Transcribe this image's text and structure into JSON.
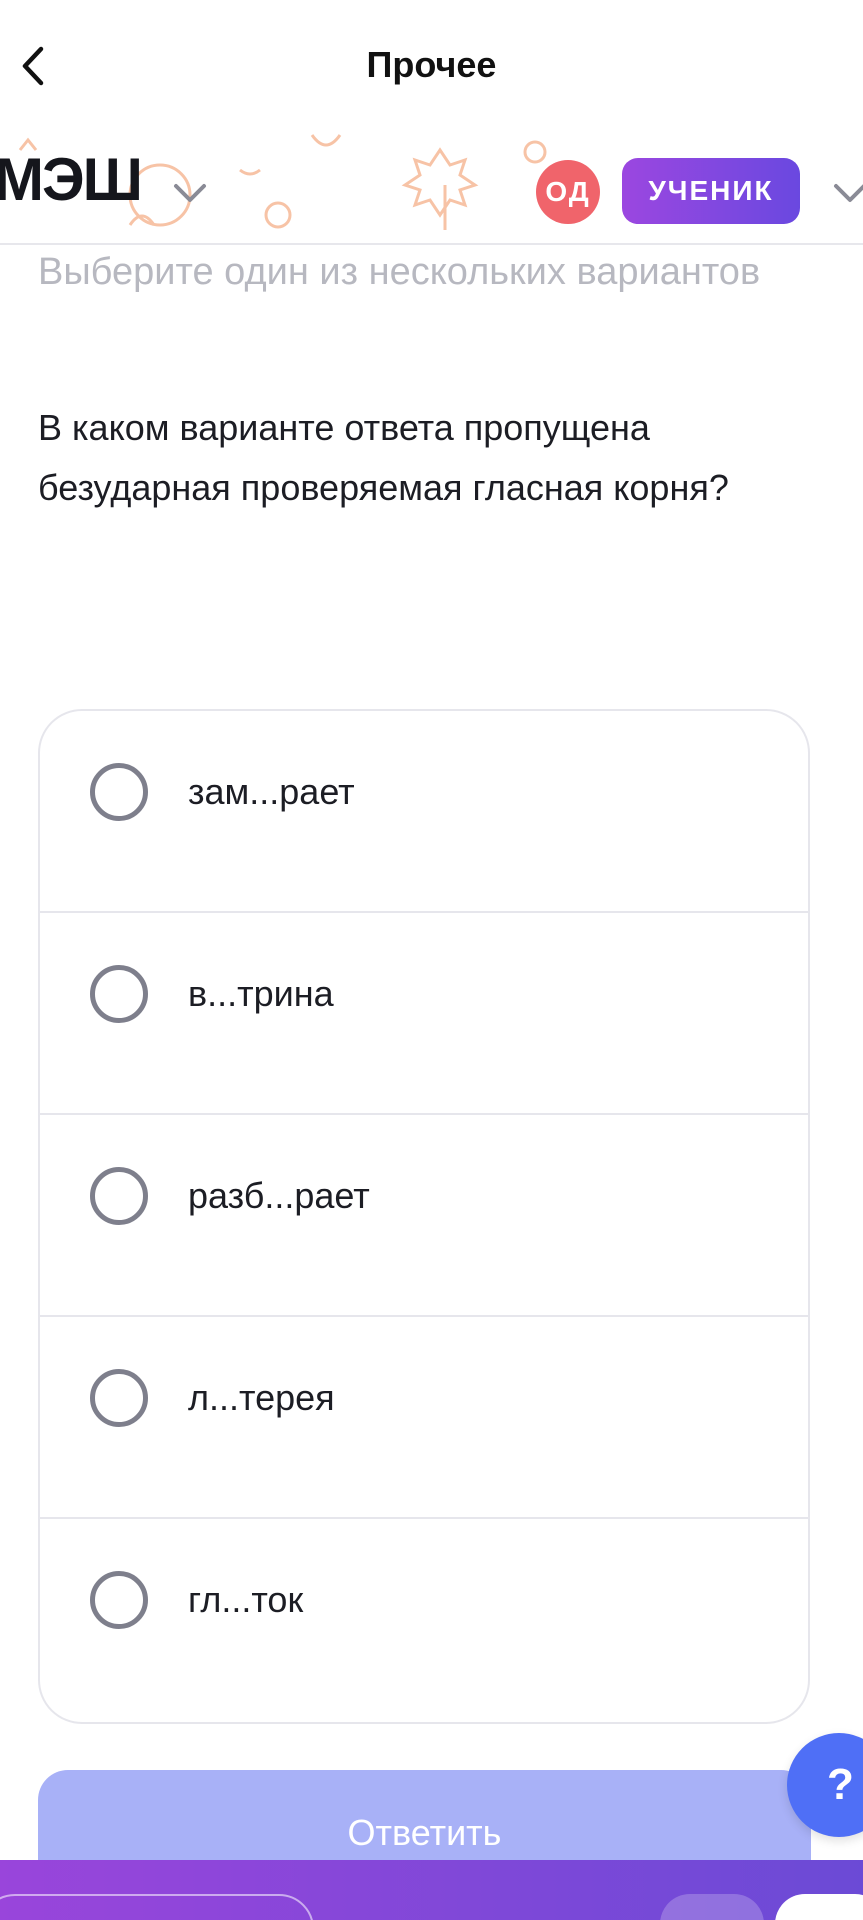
{
  "nav": {
    "title": "Прочее",
    "back_icon": "chevron-left-icon"
  },
  "brand": {
    "logo": "МЭШ",
    "avatar_initials": "ОД",
    "role_label": "УЧЕНИК",
    "colors": {
      "avatar": "#f0646b",
      "role_gradient_start": "#9b47e0",
      "role_gradient_end": "#6a48e0",
      "decor": "#f7c3a6"
    }
  },
  "question": {
    "instruction": "Выберите один из нескольких вариантов",
    "text": "В каком варианте ответа пропущена безударная проверяемая гласная корня?"
  },
  "options": [
    {
      "label": "зам...рает"
    },
    {
      "label": "в...трина"
    },
    {
      "label": "разб...рает"
    },
    {
      "label": "л...терея"
    },
    {
      "label": "гл...ток"
    }
  ],
  "submit": {
    "label": "Ответить",
    "color": "#a8b1f7"
  },
  "help": {
    "label": "?",
    "color": "#4f6ff6"
  },
  "bottom_bar": {
    "gradient_start": "#9945db",
    "gradient_end": "#6b4ad6"
  }
}
